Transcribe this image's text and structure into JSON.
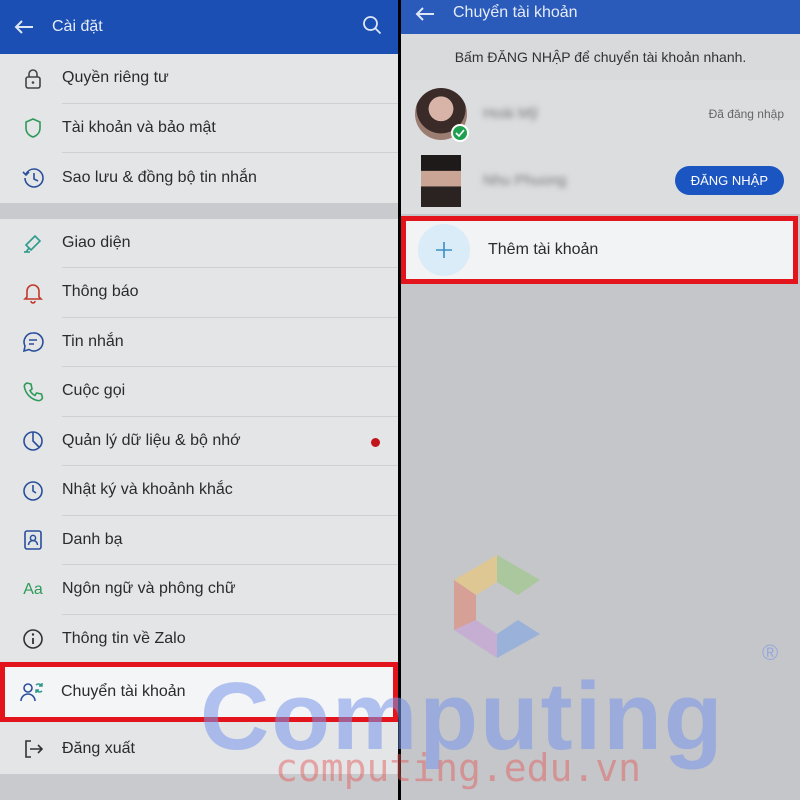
{
  "settings": {
    "title": "Cài đặt",
    "groups": [
      [
        {
          "label": "Quyền riêng tư",
          "icon": "lock-icon"
        },
        {
          "label": "Tài khoản và bảo mật",
          "icon": "shield-icon"
        },
        {
          "label": "Sao lưu & đồng bộ tin nhắn",
          "icon": "history-icon"
        }
      ],
      [
        {
          "label": "Giao diện",
          "icon": "paint-brush-icon"
        },
        {
          "label": "Thông báo",
          "icon": "bell-icon"
        },
        {
          "label": "Tin nhắn",
          "icon": "chat-bubble-icon"
        },
        {
          "label": "Cuộc gọi",
          "icon": "phone-icon"
        },
        {
          "label": "Quản lý dữ liệu & bộ nhớ",
          "icon": "pie-chart-icon"
        },
        {
          "label": "Nhật ký và khoảnh khắc",
          "icon": "clock-icon"
        },
        {
          "label": "Danh bạ",
          "icon": "contacts-icon"
        },
        {
          "label": "Ngôn ngữ và phông chữ",
          "icon": "font-icon",
          "glyph": "Aa"
        },
        {
          "label": "Thông tin về Zalo",
          "icon": "info-icon"
        },
        {
          "label": "Chuyển tài khoản",
          "icon": "switch-account-icon"
        },
        {
          "label": "Đăng xuất",
          "icon": "logout-icon"
        }
      ]
    ]
  },
  "switch_account": {
    "title": "Chuyển tài khoản",
    "hint": "Bấm ĐĂNG NHẬP để chuyển tài khoản nhanh.",
    "accounts": [
      {
        "name": "Hoài Mỹ",
        "status": "Đã đăng nhập"
      },
      {
        "name": "Nhu Phuong",
        "button": "ĐĂNG NHẬP"
      }
    ],
    "add_label": "Thêm tài khoản"
  },
  "watermark": {
    "brand": "Computing",
    "url": "computing.edu.vn",
    "registered": "®"
  },
  "colors": {
    "header_blue": "#1b4fb4",
    "highlight_red": "#e3141b",
    "accent_teal": "#2e9a8c",
    "login_blue": "#1b55c2",
    "online_green": "#1ea04f"
  }
}
